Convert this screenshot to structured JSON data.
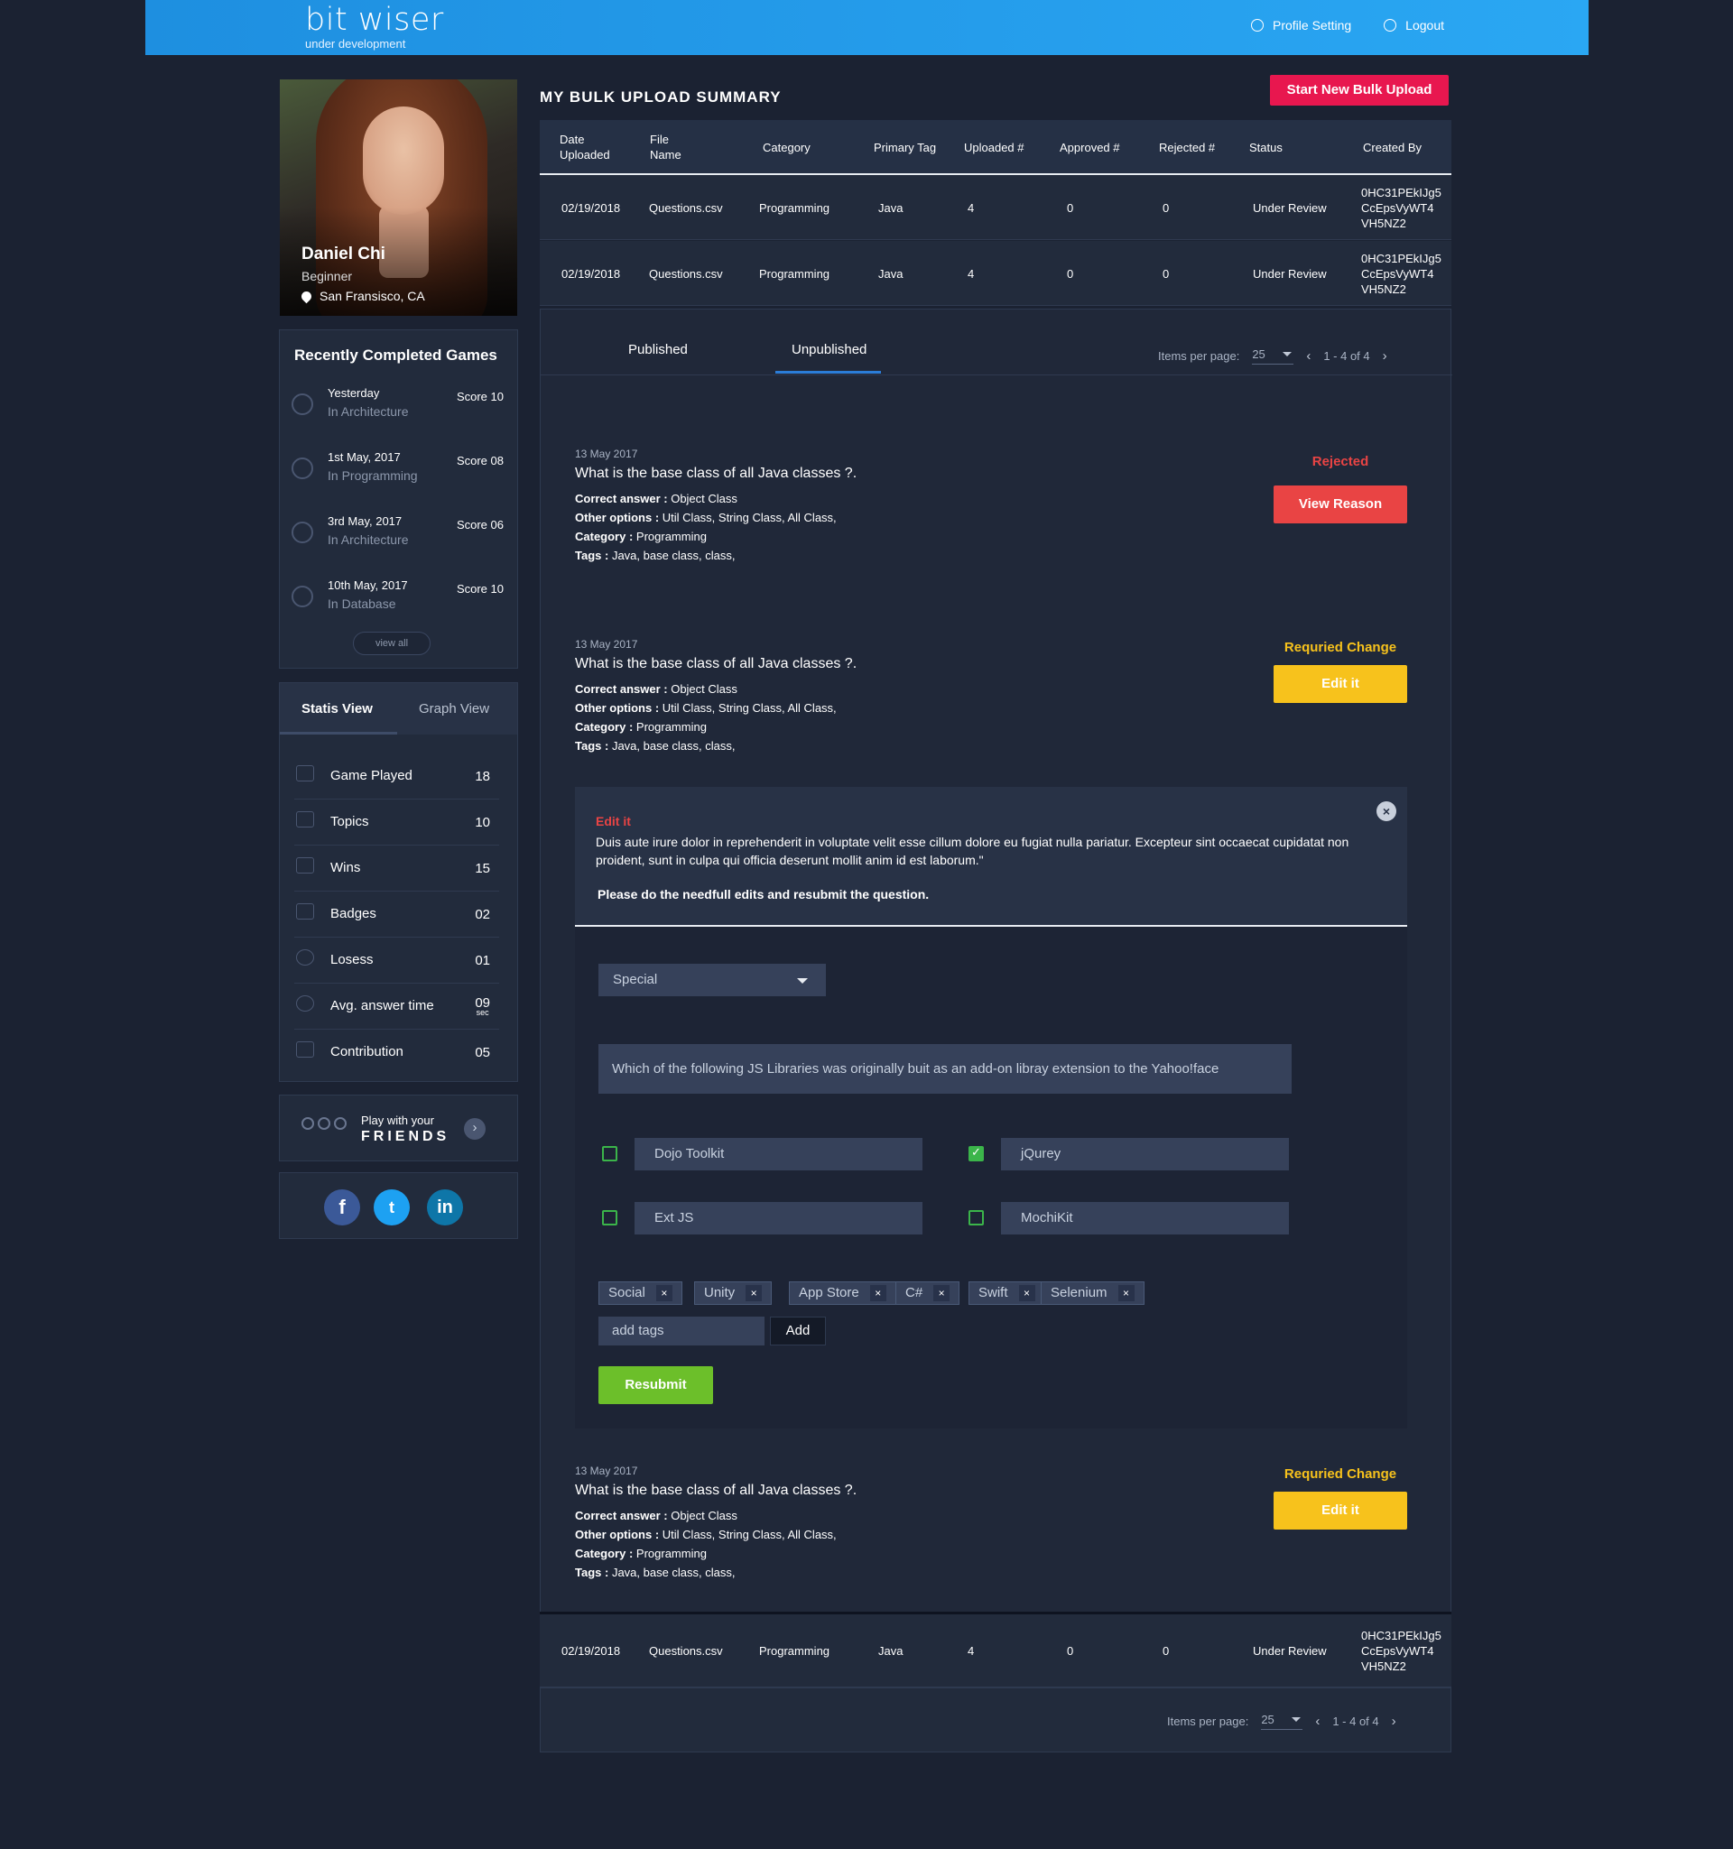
{
  "header": {
    "logo_title": "bit wiser",
    "logo_subtitle": "under development",
    "profile_setting": "Profile Setting",
    "logout": "Logout"
  },
  "profile": {
    "name": "Daniel Chi",
    "level": "Beginner",
    "location": "San Fransisco, CA"
  },
  "recent_games": {
    "title": "Recently Completed Games",
    "items": [
      {
        "date": "Yesterday",
        "category": "In Architecture",
        "score": "Score 10",
        "icon": "trophy-icon"
      },
      {
        "date": "1st May, 2017",
        "category": "In Programming",
        "score": "Score 08",
        "icon": "lose-icon"
      },
      {
        "date": "3rd May, 2017",
        "category": "In Architecture",
        "score": "Score 06",
        "icon": "lose-icon"
      },
      {
        "date": "10th May, 2017",
        "category": "In Database",
        "score": "Score 10",
        "icon": "trophy-icon"
      }
    ],
    "view_all": "view all"
  },
  "stats": {
    "tabs": [
      "Statis View",
      "Graph View"
    ],
    "items": [
      {
        "label": "Game Played",
        "value": "18",
        "icon": "game-icon"
      },
      {
        "label": "Topics",
        "value": "10",
        "icon": "topics-icon"
      },
      {
        "label": "Wins",
        "value": "15",
        "icon": "trophy-icon"
      },
      {
        "label": "Badges",
        "value": "02",
        "icon": "badge-icon"
      },
      {
        "label": "Losess",
        "value": "01",
        "icon": "lose-icon"
      },
      {
        "label": "Avg. answer time",
        "value": "09",
        "unit": "sec",
        "icon": "clock-icon"
      },
      {
        "label": "Contribution",
        "value": "05",
        "icon": "contribution-icon"
      }
    ]
  },
  "friends": {
    "line1": "Play with your",
    "line2": "FRIENDS"
  },
  "social": {
    "facebook": "f",
    "twitter": "t",
    "linkedin": "in"
  },
  "main": {
    "title": "MY BULK UPLOAD SUMMARY",
    "new_upload": "Start New Bulk Upload",
    "columns": [
      "Date Uploaded",
      "File Name",
      "Category",
      "Primary Tag",
      "Uploaded #",
      "Approved #",
      "Rejected #",
      "Status",
      "Created By"
    ],
    "rows": [
      [
        "02/19/2018",
        "Questions.csv",
        "Programming",
        "Java",
        "4",
        "0",
        "0",
        "Under Review",
        "0HC31PEkIJg5 CcEpsVyWT4 VH5NZ2"
      ],
      [
        "02/19/2018",
        "Questions.csv",
        "Programming",
        "Java",
        "4",
        "0",
        "0",
        "Under Review",
        "0HC31PEkIJg5 CcEpsVyWT4 VH5NZ2"
      ]
    ],
    "bottom_row": [
      "02/19/2018",
      "Questions.csv",
      "Programming",
      "Java",
      "4",
      "0",
      "0",
      "Under Review",
      "0HC31PEkIJg5 CcEpsVyWT4 VH5NZ2"
    ],
    "tabs": [
      "Published",
      "Unpublished"
    ],
    "items_per_page_label": "Items per page:",
    "items_per_page": "25",
    "range": "1 - 4 of 4"
  },
  "questions": [
    {
      "date": "13 May 2017",
      "title": "What is the base class of all Java classes ?.",
      "correct": "Object Class",
      "options": "Util Class, String Class, All Class,",
      "category": "Programming",
      "tags": "Java, base class, class,",
      "status": "Rejected",
      "action": "View Reason"
    },
    {
      "date": "13 May 2017",
      "title": "What is the base class of all Java classes ?.",
      "correct": "Object Class",
      "options": "Util Class, String Class, All Class,",
      "category": "Programming",
      "tags": "Java, base class, class,",
      "status": "Requried Change",
      "action": "Edit it"
    },
    {
      "date": "13 May 2017",
      "title": "What is the base class of all Java classes ?.",
      "correct": "Object Class",
      "options": "Util Class, String Class, All Class,",
      "category": "Programming",
      "tags": "Java, base class, class,",
      "status": "Requried Change",
      "action": "Edit it"
    }
  ],
  "labels": {
    "correct": "Correct answer : ",
    "options": "Other options : ",
    "category": "Category : ",
    "tags": "Tags : "
  },
  "edit": {
    "heading": "Edit it",
    "message": "Duis aute irure dolor in reprehenderit in voluptate velit esse cillum dolore eu fugiat nulla pariatur. Excepteur sint occaecat cupidatat non proident, sunt in culpa qui officia deserunt mollit anim id est laborum.\"",
    "instruction": "Please do the needfull edits and resubmit the question.",
    "type_value": "Special",
    "question_value": "Which of the following JS Libraries was originally buit as an add-on libray extension to the Yahoo!face",
    "options": [
      {
        "label": "Dojo Toolkit",
        "checked": false
      },
      {
        "label": "jQurey",
        "checked": true
      },
      {
        "label": "Ext JS",
        "checked": false
      },
      {
        "label": "MochiKit",
        "checked": false
      }
    ],
    "tags": [
      "Social",
      "Unity",
      "App Store",
      "C#",
      "Swift",
      "Selenium"
    ],
    "add_tags_placeholder": "add tags",
    "add_button": "Add",
    "resubmit": "Resubmit"
  },
  "colors": {
    "accent_blue": "#2aa7f3",
    "rejected": "#e94444",
    "warning": "#f7c21c",
    "success": "#6cbf2a",
    "primary_pink": "#e8174f"
  }
}
